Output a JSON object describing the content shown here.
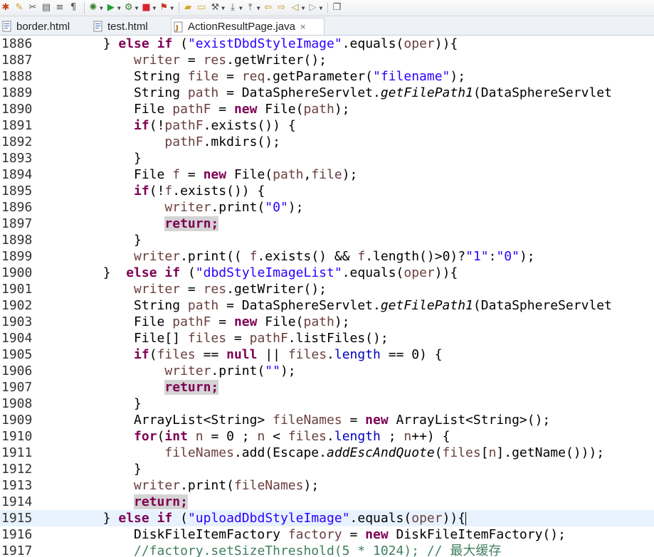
{
  "toolbar": {
    "icons": [
      "debug-icon",
      "pencil-icon",
      "scissors-icon",
      "note-icon",
      "list-icon",
      "paragraph-icon",
      "bug-icon",
      "run-icon",
      "external-tools-icon",
      "stop-icon",
      "build-icon",
      "open-folder-icon",
      "folder-icon",
      "wrench-icon",
      "next-annotation-icon",
      "previous-annotation-icon",
      "back-icon",
      "forward-icon",
      "arrow-left-icon",
      "arrow-right-icon",
      "new-window-icon"
    ],
    "colors": {
      "run": "#1e9e2c",
      "stop": "#d9232e",
      "debug": "#c8431a"
    }
  },
  "tabs": [
    {
      "label": "border.html",
      "icon": "html-file-icon"
    },
    {
      "label": "test.html",
      "icon": "html-file-icon"
    },
    {
      "label": "ActionResultPage.java",
      "icon": "java-file-icon",
      "active": true,
      "close": "×"
    }
  ],
  "editor": {
    "current_line": 1915,
    "lines": [
      {
        "n": "1886",
        "code": "        } [[k:else]] [[k:if]] ([[s:\"existDbdStyleImage\"]].equals([[v:oper]])){"
      },
      {
        "n": "1887",
        "code": "            [[v:writer]] = [[v:res]].getWriter();"
      },
      {
        "n": "1888",
        "code": "            String [[v:file]] = [[v:req]].getParameter([[s:\"filename\"]]);"
      },
      {
        "n": "1889",
        "code": "            String [[v:path]] = DataSphereServlet.[[m:getFilePath1]](DataSphereServlet"
      },
      {
        "n": "1890",
        "code": "            File [[v:pathF]] = [[k:new]] File([[v:path]]);"
      },
      {
        "n": "1891",
        "code": "            [[k:if]](![[v:pathF]].exists()) {"
      },
      {
        "n": "1892",
        "code": "                [[v:pathF]].mkdirs();"
      },
      {
        "n": "1893",
        "code": "            }"
      },
      {
        "n": "1894",
        "code": "            File [[v:f]] = [[k:new]] File([[v:path]],[[v:file]]);"
      },
      {
        "n": "1895",
        "code": "            [[k:if]](![[v:f]].exists()) {"
      },
      {
        "n": "1896",
        "code": "                [[v:writer]].print([[s:\"0\"]]);"
      },
      {
        "n": "1897",
        "code": "                [[h:return;]]"
      },
      {
        "n": "1898",
        "code": "            }"
      },
      {
        "n": "1899",
        "code": "            [[v:writer]].print(( [[v:f]].exists() && [[v:f]].length()>0)?[[s:\"1\"]]:[[s:\"0\"]]);"
      },
      {
        "n": "1900",
        "code": "        }  [[k:else]] [[k:if]] ([[s:\"dbdStyleImageList\"]].equals([[v:oper]])){"
      },
      {
        "n": "1901",
        "code": "            [[v:writer]] = [[v:res]].getWriter();"
      },
      {
        "n": "1902",
        "code": "            String [[v:path]] = DataSphereServlet.[[m:getFilePath1]](DataSphereServlet"
      },
      {
        "n": "1903",
        "code": "            File [[v:pathF]] = [[k:new]] File([[v:path]]);"
      },
      {
        "n": "1904",
        "code": "            File[] [[v:files]] = [[v:pathF]].listFiles();"
      },
      {
        "n": "1905",
        "code": "            [[k:if]]([[v:files]] == [[k:null]] || [[v:files]].[[f:length]] == 0) {"
      },
      {
        "n": "1906",
        "code": "                [[v:writer]].print([[s:\"\"]]);"
      },
      {
        "n": "1907",
        "code": "                [[h:return;]]"
      },
      {
        "n": "1908",
        "code": "            }"
      },
      {
        "n": "1909",
        "code": "            ArrayList<String> [[v:fileNames]] = [[k:new]] ArrayList<String>();"
      },
      {
        "n": "1910",
        "code": "            [[k:for]]([[k:int]] [[v:n]] = 0 ; [[v:n]] < [[v:files]].[[f:length]] ; [[v:n]]++) {"
      },
      {
        "n": "1911",
        "code": "                [[v:fileNames]].add(Escape.[[m:addEscAndQuote]]([[v:files]][[[v:n]]].getName()));"
      },
      {
        "n": "1912",
        "code": "            }"
      },
      {
        "n": "1913",
        "code": "            [[v:writer]].print([[v:fileNames]]);"
      },
      {
        "n": "1914",
        "code": "            [[h:return;]]"
      },
      {
        "n": "1915",
        "code": "        } [[k:else]] [[k:if]] ([[s:\"uploadDbdStyleImage\"]].equals([[v:oper]])){[[c:]]"
      },
      {
        "n": "1916",
        "code": "            DiskFileItemFactory [[v:factory]] = [[k:new]] DiskFileItemFactory();"
      },
      {
        "n": "1917",
        "code": "            [[g://factory.setSizeThreshold(5 * 1024); // 最大缓存]]"
      }
    ]
  }
}
